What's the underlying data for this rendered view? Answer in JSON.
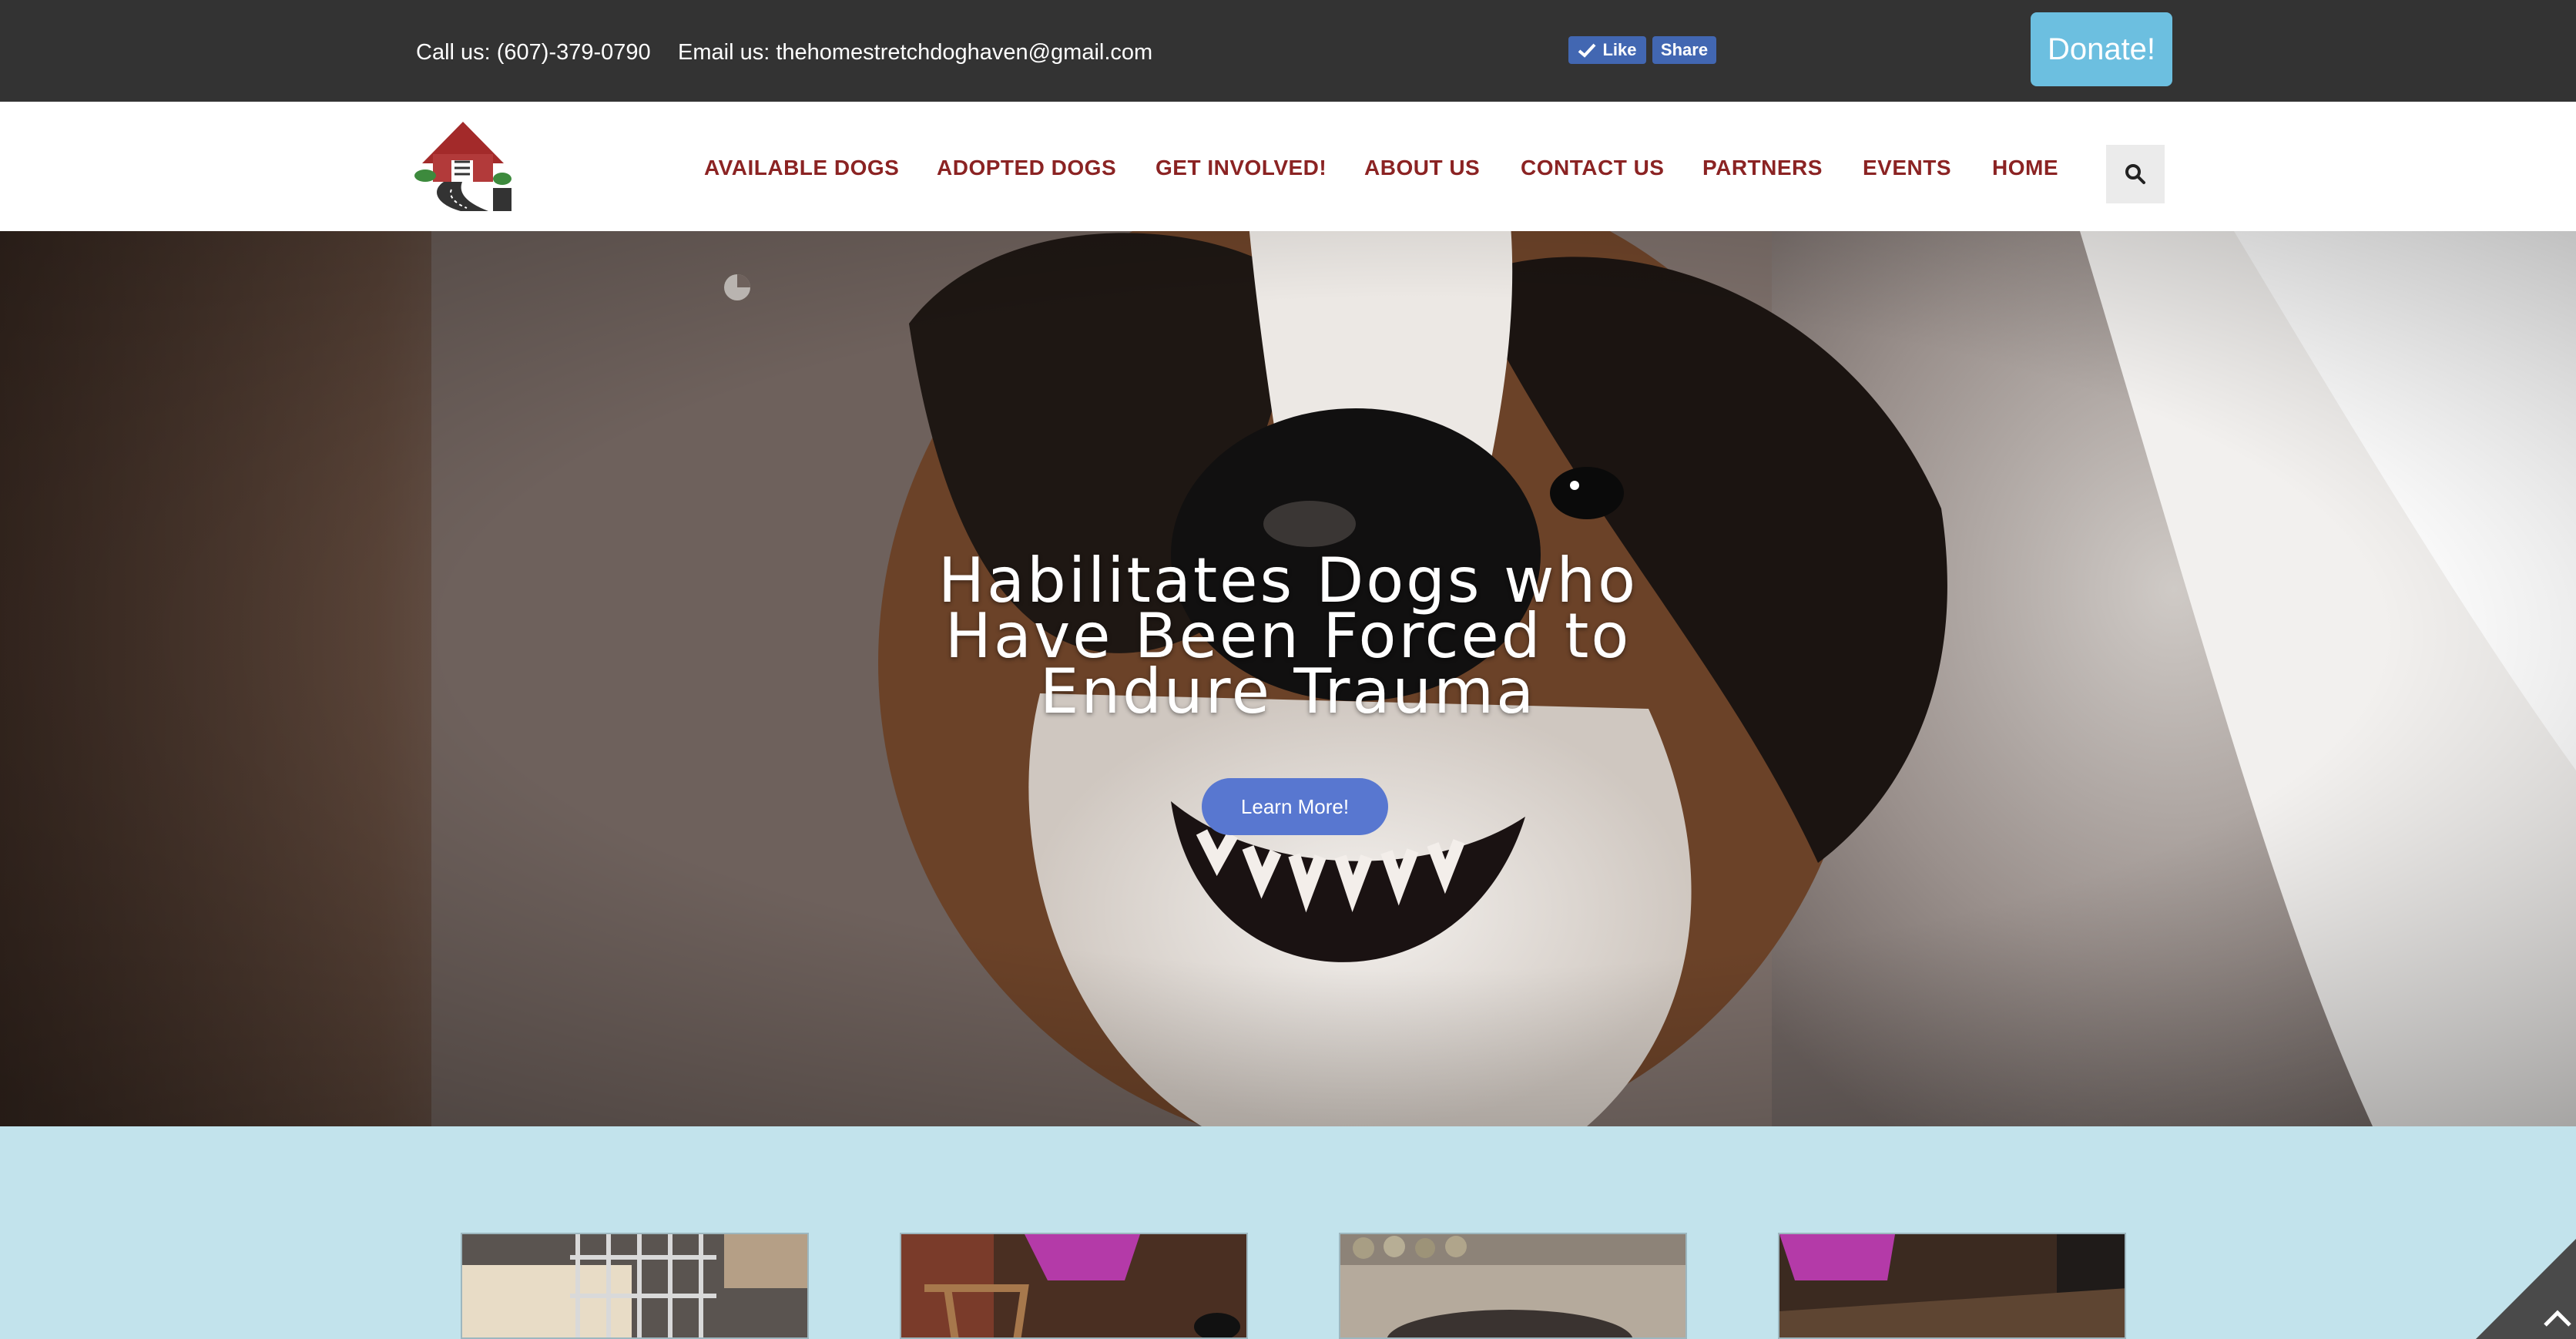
{
  "topbar": {
    "phone": "Call us: (607)-379-0790",
    "email": "Email us: thehomestretchdoghaven@gmail.com",
    "fb_like": "Like",
    "fb_share": "Share",
    "donate": "Donate!"
  },
  "nav": {
    "items": [
      {
        "label": "AVAILABLE DOGS"
      },
      {
        "label": "ADOPTED DOGS"
      },
      {
        "label": "GET INVOLVED!"
      },
      {
        "label": "ABOUT US"
      },
      {
        "label": "CONTACT US"
      },
      {
        "label": "PARTNERS"
      },
      {
        "label": "EVENTS"
      },
      {
        "label": "HOME"
      }
    ],
    "search_icon": "search-icon"
  },
  "hero": {
    "title_lines": [
      "Habilitates Dogs who",
      "Have Been Forced to",
      "Endure Trauma"
    ],
    "button": "Learn More!"
  },
  "colors": {
    "topbar_bg": "#333333",
    "nav_text": "#8b2323",
    "donate_bg": "#6cbfe0",
    "button_bg": "#5877d0",
    "section_bg": "#c2e3ec"
  }
}
